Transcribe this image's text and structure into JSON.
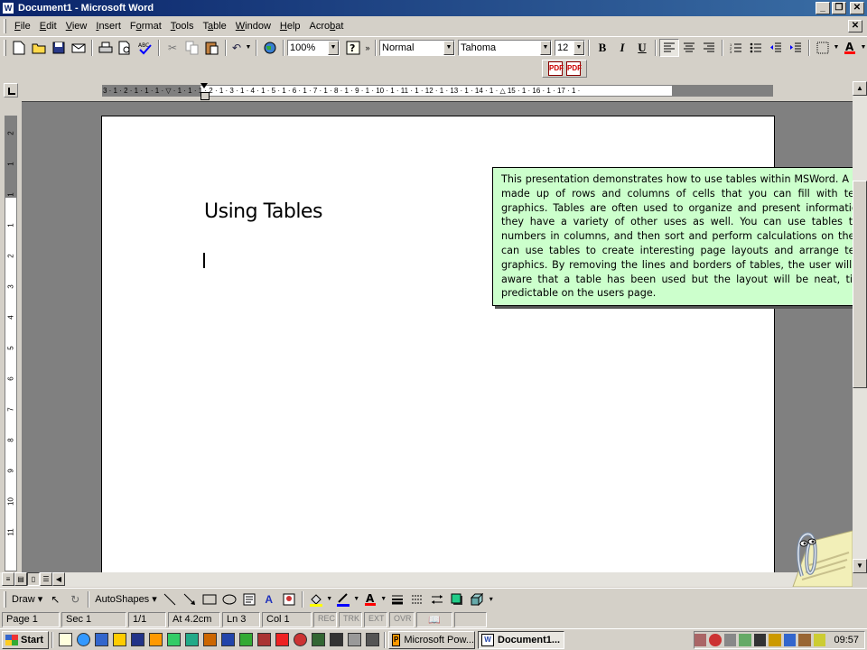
{
  "window": {
    "title": "Document1 - Microsoft Word",
    "app_icon": "W"
  },
  "menu": [
    {
      "label": "File",
      "u": "F",
      "rest": "ile"
    },
    {
      "label": "Edit",
      "u": "E",
      "rest": "dit"
    },
    {
      "label": "View",
      "u": "V",
      "rest": "iew"
    },
    {
      "label": "Insert",
      "u": "I",
      "rest": "nsert"
    },
    {
      "label": "Format",
      "pre": "F",
      "u": "o",
      "rest": "rmat"
    },
    {
      "label": "Tools",
      "u": "T",
      "rest": "ools"
    },
    {
      "label": "Table",
      "pre": "T",
      "u": "a",
      "rest": "ble"
    },
    {
      "label": "Window",
      "u": "W",
      "rest": "indow"
    },
    {
      "label": "Help",
      "u": "H",
      "rest": "elp"
    },
    {
      "label": "Acrobat",
      "pre": "Acro",
      "u": "b",
      "rest": "at"
    }
  ],
  "toolbar": {
    "zoom": "100%",
    "style": "Normal",
    "font": "Tahoma",
    "size": "12",
    "bold": "B",
    "italic": "I",
    "underline": "U",
    "font_color": "#ff0000"
  },
  "ruler": {
    "numbers": "3 · 1 · 2 · 1 · 1 · 1 · ▽ · 1 · 1 · 1 · 2 · 1 · 3 · 1 · 4 · 1 · 5 · 1 · 6 · 1 · 7 · 1 · 8 · 1 · 9 · 1 · 10 · 1 · 11 · 1 · 12 · 1 · 13 · 1 · 14 · 1 · △ 15 · 1 · 16 · 1 · 17 · 1 ·",
    "vertical": [
      "2",
      "1",
      "1",
      "1",
      "2",
      "3",
      "4",
      "5",
      "6",
      "7",
      "8",
      "9",
      "10",
      "11"
    ]
  },
  "document": {
    "heading": "Using Tables",
    "callout": "This presentation demonstrates how to use tables within MSWord. A table is made up of rows and columns of cells that you can fill with text and graphics. Tables are often used to organize and present information, but they have a variety of other uses as well. You can use tables to align numbers in columns, and then sort and perform calculations on them. You can use tables to create interesting page layouts and arrange text and graphics. By removing the lines and borders of tables, the user will not be aware that a table has been used but the layout will be neat, tidy and predictable on the users page.",
    "callout_color": "#ccffcc"
  },
  "drawbar": {
    "draw": "Draw",
    "autoshapes": "AutoShapes"
  },
  "status": {
    "page": "Page 1",
    "sec": "Sec 1",
    "pages": "1/1",
    "at": "At 4.2cm",
    "ln": "Ln 3",
    "col": "Col 1",
    "rec": "REC",
    "trk": "TRK",
    "ext": "EXT",
    "ovr": "OVR"
  },
  "taskbar": {
    "start": "Start",
    "tasks": [
      "Microsoft Pow...",
      "Document1..."
    ],
    "clock": "09:57"
  }
}
